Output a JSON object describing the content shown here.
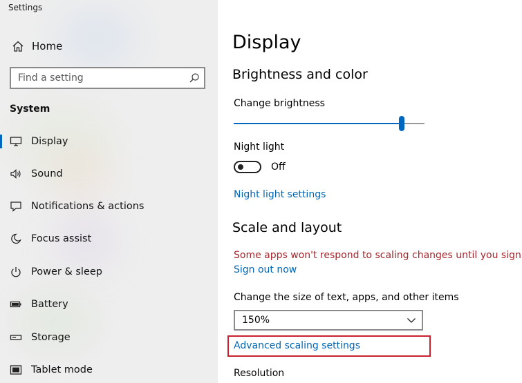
{
  "window": {
    "title": "Settings"
  },
  "sidebar": {
    "home_label": "Home",
    "search_placeholder": "Find a setting",
    "section_label": "System",
    "items": [
      {
        "label": "Display",
        "icon": "monitor-icon",
        "active": true
      },
      {
        "label": "Sound",
        "icon": "speaker-icon",
        "active": false
      },
      {
        "label": "Notifications & actions",
        "icon": "notification-icon",
        "active": false
      },
      {
        "label": "Focus assist",
        "icon": "moon-icon",
        "active": false
      },
      {
        "label": "Power & sleep",
        "icon": "power-icon",
        "active": false
      },
      {
        "label": "Battery",
        "icon": "battery-icon",
        "active": false
      },
      {
        "label": "Storage",
        "icon": "storage-icon",
        "active": false
      },
      {
        "label": "Tablet mode",
        "icon": "tablet-icon",
        "active": false
      }
    ]
  },
  "main": {
    "title": "Display",
    "brightness_heading": "Brightness and color",
    "brightness_label": "Change brightness",
    "brightness_level": 0.88,
    "night_light_label": "Night light",
    "night_light_state": "Off",
    "night_light_link": "Night light settings",
    "scale_heading": "Scale and layout",
    "scale_warning": "Some apps won't respond to scaling changes until you sign out.",
    "sign_out_link": "Sign out now",
    "size_label": "Change the size of text, apps, and other items",
    "size_value": "150%",
    "advanced_link": "Advanced scaling settings",
    "resolution_label": "Resolution"
  },
  "colors": {
    "accent": "#0067c0",
    "link": "#0066b4",
    "warning": "#a4262c",
    "highlight": "#c8202c",
    "sidebar_bg": "#eeeeee"
  }
}
